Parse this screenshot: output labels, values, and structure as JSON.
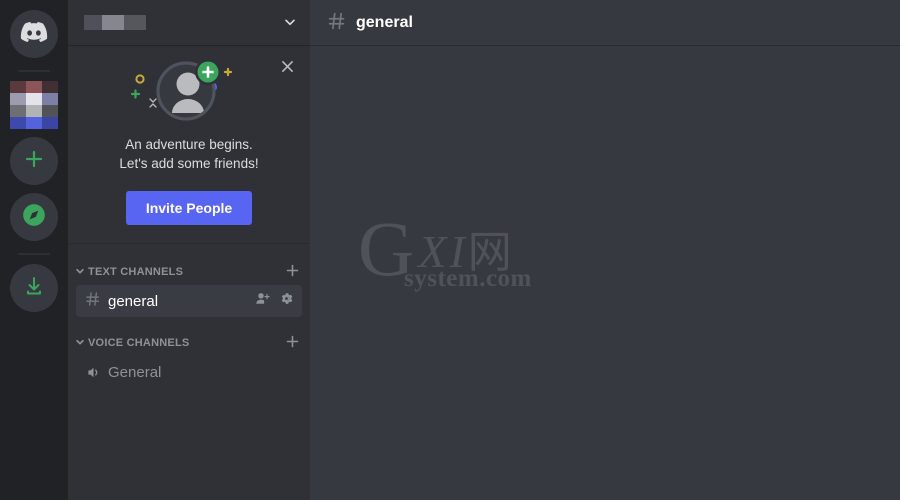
{
  "colors": {
    "rail_bg": "#202225",
    "sidebar_bg": "#2f3136",
    "main_bg": "#36393f",
    "accent_blurple": "#5865f2",
    "accent_green": "#3ba55d",
    "channel_active_bg": "#393c43",
    "text_muted": "#8e9297",
    "text_bright": "#ffffff"
  },
  "rail": {
    "home_icon": "discord-logo-icon",
    "server": {
      "name_censored": true,
      "icon": "censored-server-icon"
    },
    "add_server_label": "+",
    "add_server_icon": "plus-icon",
    "explore_icon": "compass-icon",
    "download_icon": "download-icon"
  },
  "sidebar": {
    "header": {
      "server_name_censored": true,
      "chevron": "⌄",
      "chevron_icon": "chevron-down-icon"
    },
    "promo": {
      "close_icon": "✕",
      "line1": "An adventure begins.",
      "line2": "Let's add some friends!",
      "button_label": "Invite People",
      "art_icon": "add-friend-avatar-illustration"
    },
    "categories": [
      {
        "label": "TEXT CHANNELS",
        "arrow": "⌄",
        "add_icon": "+",
        "channels": [
          {
            "name": "general",
            "prefix": "#",
            "active": true,
            "actions": [
              "create-invite-icon",
              "edit-channel-gear-icon"
            ]
          }
        ]
      },
      {
        "label": "VOICE CHANNELS",
        "arrow": "⌄",
        "add_icon": "+",
        "channels": [
          {
            "name": "General",
            "prefix": "speaker-icon",
            "active": false,
            "actions": []
          }
        ]
      }
    ]
  },
  "main": {
    "hash": "#",
    "channel_title": "general",
    "watermark": {
      "brand": "G",
      "mid": "XI",
      "cn": "网",
      "sub": "system.com"
    }
  }
}
